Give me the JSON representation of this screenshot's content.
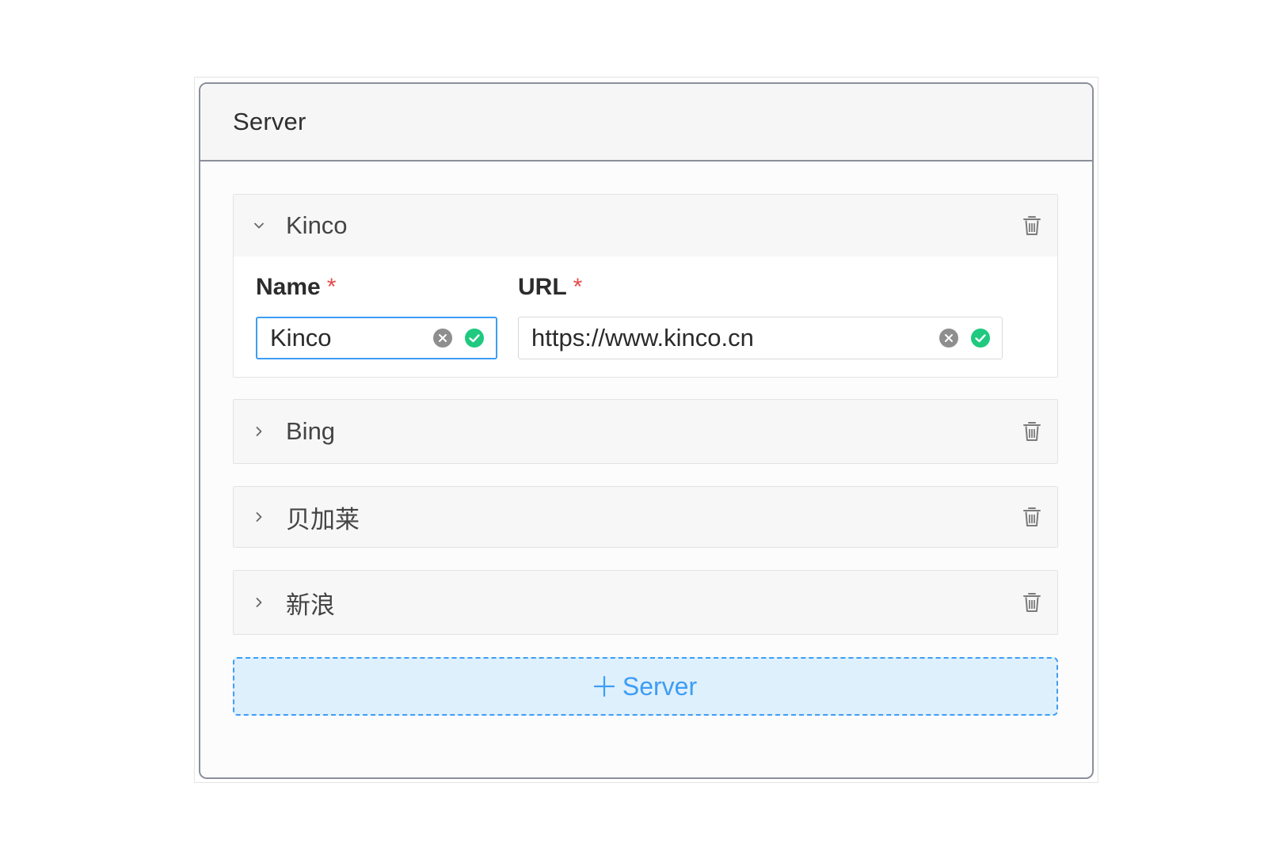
{
  "panel": {
    "title": "Server"
  },
  "servers": [
    {
      "title": "Kinco",
      "expanded": true,
      "name_label": "Name",
      "url_label": "URL",
      "required_mark": "*",
      "name_value": "Kinco",
      "url_value": "https://www.kinco.cn"
    },
    {
      "title": "Bing",
      "expanded": false
    },
    {
      "title": "贝加莱",
      "expanded": false
    },
    {
      "title": "新浪",
      "expanded": false
    }
  ],
  "add_button": {
    "label": "Server"
  },
  "colors": {
    "accent": "#3d9df5",
    "success": "#1fc97f",
    "required": "#e54b4b",
    "clear": "#8e8e8e"
  },
  "icons": {
    "expanded": "chevron-down-icon",
    "collapsed": "chevron-right-icon",
    "delete": "trash-icon",
    "clear": "clear-circle-icon",
    "valid": "check-circle-icon",
    "add": "plus-icon"
  }
}
